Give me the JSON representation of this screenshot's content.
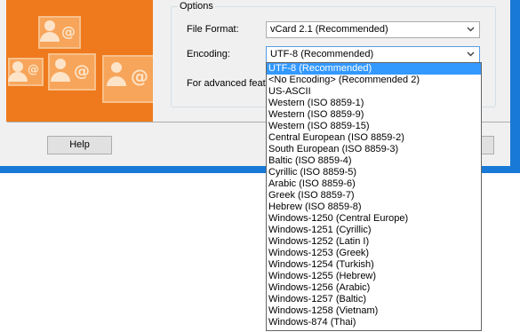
{
  "options": {
    "group_label": "Options",
    "file_format_label": "File Format:",
    "file_format_value": "vCard 2.1 (Recommended)",
    "encoding_label": "Encoding:",
    "encoding_value": "UTF-8 (Recommended)",
    "advanced_text": "For advanced feat"
  },
  "buttons": {
    "help": "Help"
  },
  "encoding_options": [
    "UTF-8 (Recommended)",
    "<No Encoding> (Recommended 2)",
    "US-ASCII",
    "Western (ISO 8859-1)",
    "Western (ISO 8859-9)",
    "Western (ISO 8859-15)",
    "Central European (ISO 8859-2)",
    "South European (ISO 8859-3)",
    "Baltic (ISO 8859-4)",
    "Cyrillic (ISO 8859-5)",
    "Arabic (ISO 8859-6)",
    "Greek (ISO 8859-7)",
    "Hebrew (ISO 8859-8)",
    "Windows-1250 (Central Europe)",
    "Windows-1251 (Cyrillic)",
    "Windows-1252 (Latin I)",
    "Windows-1253 (Greek)",
    "Windows-1254 (Turkish)",
    "Windows-1255 (Hebrew)",
    "Windows-1256 (Arabic)",
    "Windows-1257 (Baltic)",
    "Windows-1258 (Vietnam)",
    "Windows-874  (Thai)"
  ],
  "selected_index": 0,
  "colors": {
    "accent_orange": "#ee7a1d",
    "window_border": "#1879d6",
    "selection": "#3399ff"
  },
  "icons": {
    "side_image": "contact-cards-illustration",
    "dropdown_arrow": "chevron-down-icon"
  }
}
